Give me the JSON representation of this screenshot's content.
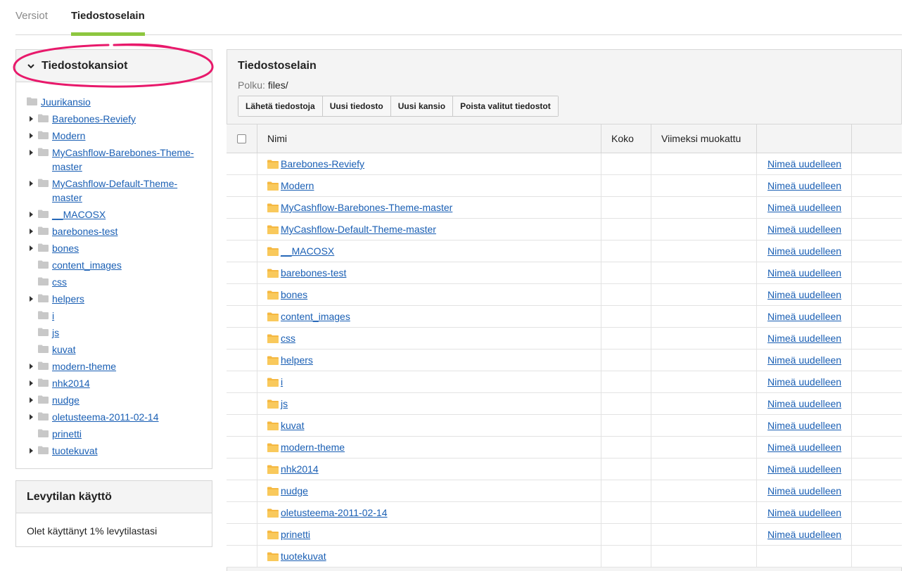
{
  "tabs": [
    {
      "label": "Versiot",
      "active": false
    },
    {
      "label": "Tiedostoselain",
      "active": true
    }
  ],
  "folders_panel": {
    "title": "Tiedostokansiot",
    "root": {
      "label": "Juurikansio"
    },
    "items": [
      {
        "label": "Barebones-Reviefy",
        "expandable": true
      },
      {
        "label": "Modern",
        "expandable": true
      },
      {
        "label": "MyCashflow-Barebones-Theme-master",
        "expandable": true
      },
      {
        "label": "MyCashflow-Default-Theme-master",
        "expandable": true
      },
      {
        "label": "__MACOSX",
        "expandable": true
      },
      {
        "label": "barebones-test",
        "expandable": true
      },
      {
        "label": "bones",
        "expandable": true
      },
      {
        "label": "content_images",
        "expandable": false
      },
      {
        "label": "css",
        "expandable": false
      },
      {
        "label": "helpers",
        "expandable": true
      },
      {
        "label": "i",
        "expandable": false
      },
      {
        "label": "js",
        "expandable": false
      },
      {
        "label": "kuvat",
        "expandable": false
      },
      {
        "label": "modern-theme",
        "expandable": true
      },
      {
        "label": "nhk2014",
        "expandable": true
      },
      {
        "label": "nudge",
        "expandable": true
      },
      {
        "label": "oletusteema-2011-02-14",
        "expandable": true
      },
      {
        "label": "prinetti",
        "expandable": false
      },
      {
        "label": "tuotekuvat",
        "expandable": true
      }
    ]
  },
  "disk_panel": {
    "title": "Levytilan käyttö",
    "text": "Olet käyttänyt 1% levytilastasi"
  },
  "browser": {
    "title": "Tiedostoselain",
    "path_label": "Polku:",
    "path_value": "files/",
    "buttons": [
      "Lähetä tiedostoja",
      "Uusi tiedosto",
      "Uusi kansio",
      "Poista valitut tiedostot"
    ],
    "columns": {
      "name": "Nimi",
      "size": "Koko",
      "modified": "Viimeksi muokattu"
    },
    "rename_label": "Nimeä uudelleen",
    "rows": [
      {
        "name": "Barebones-Reviefy",
        "rename": true
      },
      {
        "name": "Modern",
        "rename": true
      },
      {
        "name": "MyCashflow-Barebones-Theme-master",
        "rename": true
      },
      {
        "name": "MyCashflow-Default-Theme-master",
        "rename": true
      },
      {
        "name": "__MACOSX",
        "rename": true
      },
      {
        "name": "barebones-test",
        "rename": true
      },
      {
        "name": "bones",
        "rename": true
      },
      {
        "name": "content_images",
        "rename": true
      },
      {
        "name": "css",
        "rename": true
      },
      {
        "name": "helpers",
        "rename": true
      },
      {
        "name": "i",
        "rename": true
      },
      {
        "name": "js",
        "rename": true
      },
      {
        "name": "kuvat",
        "rename": true
      },
      {
        "name": "modern-theme",
        "rename": true
      },
      {
        "name": "nhk2014",
        "rename": true
      },
      {
        "name": "nudge",
        "rename": true
      },
      {
        "name": "oletusteema-2011-02-14",
        "rename": true
      },
      {
        "name": "prinetti",
        "rename": true
      },
      {
        "name": "tuotekuvat",
        "rename": false
      }
    ]
  },
  "colors": {
    "accent": "#8dc63f",
    "link": "#1a5fb4",
    "annotation": "#e8196b",
    "folder_yellow": "#f5b841",
    "folder_gray": "#c8c8c8"
  },
  "icons": {
    "tree_folder": "folder-icon",
    "row_folder": "folder-icon",
    "expand": "caret-right-icon",
    "collapse": "chevron-down-icon"
  }
}
